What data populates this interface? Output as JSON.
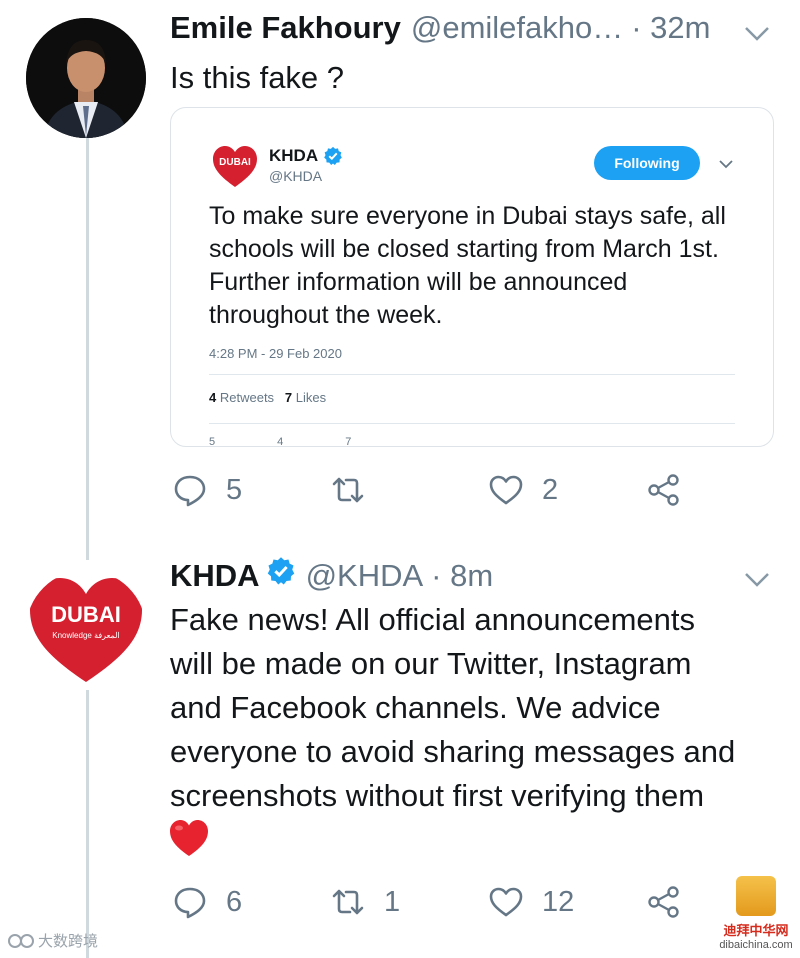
{
  "tweets": [
    {
      "name": "Emile Fakhoury",
      "handle": "@emilefakho…",
      "time": "· 32m",
      "text": "Is this fake ?",
      "actions": {
        "replies": "5",
        "retweets": "",
        "likes": "2"
      },
      "quoted": {
        "name": "KHDA",
        "handle": "@KHDA",
        "follow_label": "Following",
        "logo_text": "DUBAI",
        "text": "To make sure everyone in Dubai stays safe, all schools will be closed starting from March 1st. Further information will be announced throughout the week.",
        "timestamp": "4:28 PM - 29 Feb 2020",
        "retweets_count": "4",
        "retweets_label": "Retweets",
        "likes_count": "7",
        "likes_label": "Likes",
        "action_counts": {
          "replies": "5",
          "retweets": "4",
          "likes": "7"
        }
      }
    },
    {
      "name": "KHDA",
      "handle": "@KHDA",
      "time": "· 8m",
      "logo_text": "DUBAI",
      "logo_subtext": "Knowledge المعرفة",
      "text_lines": [
        "Fake news! All official announcements",
        "will be made on our Twitter, Instagram",
        "and Facebook channels. We advice",
        "everyone to avoid sharing messages and",
        "screenshots without first verifying them"
      ],
      "actions": {
        "replies": "6",
        "retweets": "1",
        "likes": "12"
      }
    }
  ],
  "watermarks": {
    "left": "大数跨境",
    "right_cn": "迪拜中华网",
    "right_site": "dibaichina.com"
  },
  "colors": {
    "accent": "#1da1f2",
    "text": "#14171a",
    "muted": "#657786",
    "dubai_red": "#d5202f"
  },
  "icons": [
    "reply-icon",
    "retweet-icon",
    "like-icon",
    "share-icon",
    "verified-badge-icon",
    "chevron-down-icon",
    "red-heart-emoji"
  ]
}
